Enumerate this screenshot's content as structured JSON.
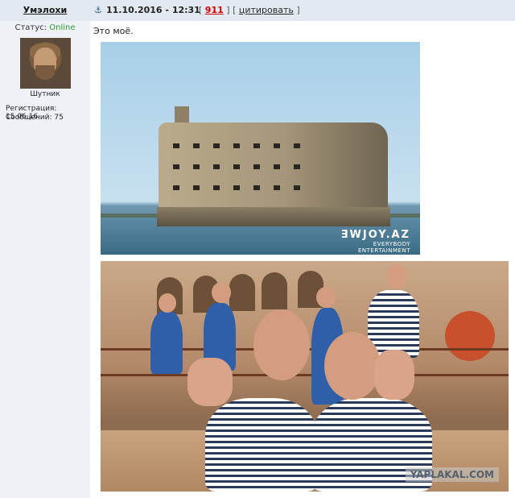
{
  "author": {
    "name": "Умэлохи",
    "status_label": "Статус:",
    "status_value": "Online",
    "title": "Шутник",
    "registration": "Регистрация: 15.06.16",
    "messages": "Сообщений: 75"
  },
  "header": {
    "anchor_icon": "⚓",
    "date": "11.10.2016 - 12:31",
    "bracket_open": "[",
    "rating": "911",
    "bracket_close": "]",
    "quote_open": "[",
    "quote_label": "цитировать",
    "quote_close": "]"
  },
  "post": {
    "text": "Это моё.",
    "image1_watermark_big": "ƎWJOY.AZ",
    "image1_watermark_small1": "EVERYBODY",
    "image1_watermark_small2": "ENTERTAINMENT",
    "image2_watermark": "YAPLAKAL.COM"
  },
  "colors": {
    "online": "#2a9d2a",
    "rating": "#cc0000",
    "header_bg": "#e3e9f1",
    "sidebar_bg": "#eef2f7"
  }
}
